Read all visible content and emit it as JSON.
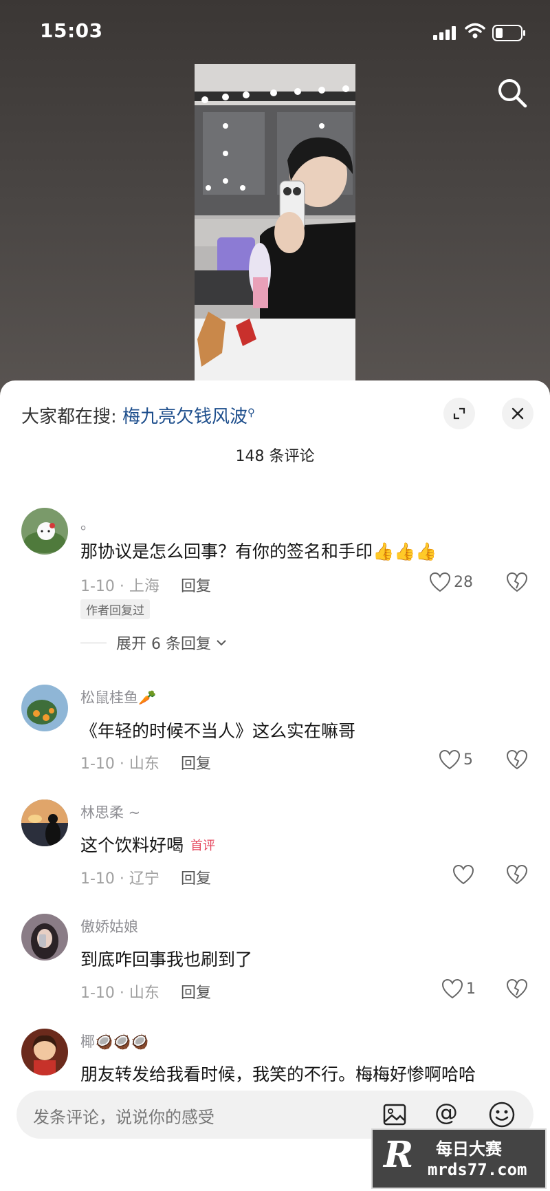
{
  "status_bar": {
    "time": "15:03"
  },
  "sheet": {
    "hot_search_prefix": "大家都在搜: ",
    "hot_search_term": "梅九亮欠钱风波",
    "comment_count": "148 条评论"
  },
  "comments": [
    {
      "username": "。",
      "text": "那协议是怎么回事？有你的签名和手印👍👍👍",
      "date_location": "1-10 · 上海",
      "reply": "回复",
      "likes": "28",
      "author_tag": "作者回复过",
      "expand": "展开 6 条回复"
    },
    {
      "username": "松鼠桂鱼🥕",
      "text": "《年轻的时候不当人》这么实在嘛哥",
      "date_location": "1-10 · 山东",
      "reply": "回复",
      "likes": "5"
    },
    {
      "username": "林思柔 ~",
      "text": "这个饮料好喝",
      "tag": "首评",
      "date_location": "1-10 · 辽宁",
      "reply": "回复",
      "likes": ""
    },
    {
      "username": "傲娇姑娘",
      "text": "到底咋回事我也刷到了",
      "date_location": "1-10 · 山东",
      "reply": "回复",
      "likes": "1"
    },
    {
      "username": "椰🥥🥥🥥",
      "text": "朋友转发给我看时候，我笑的不行。梅梅好惨啊哈哈"
    }
  ],
  "input": {
    "placeholder": "发条评论，说说你的感受"
  },
  "watermark": {
    "r": "R",
    "line1": "每日大赛",
    "line2": "mrds77.com"
  },
  "icons": [
    "search-icon",
    "expand-icon",
    "close-icon",
    "heart-icon",
    "broken-heart-icon",
    "image-icon",
    "at-icon",
    "emoji-icon",
    "chevron-down-icon"
  ]
}
